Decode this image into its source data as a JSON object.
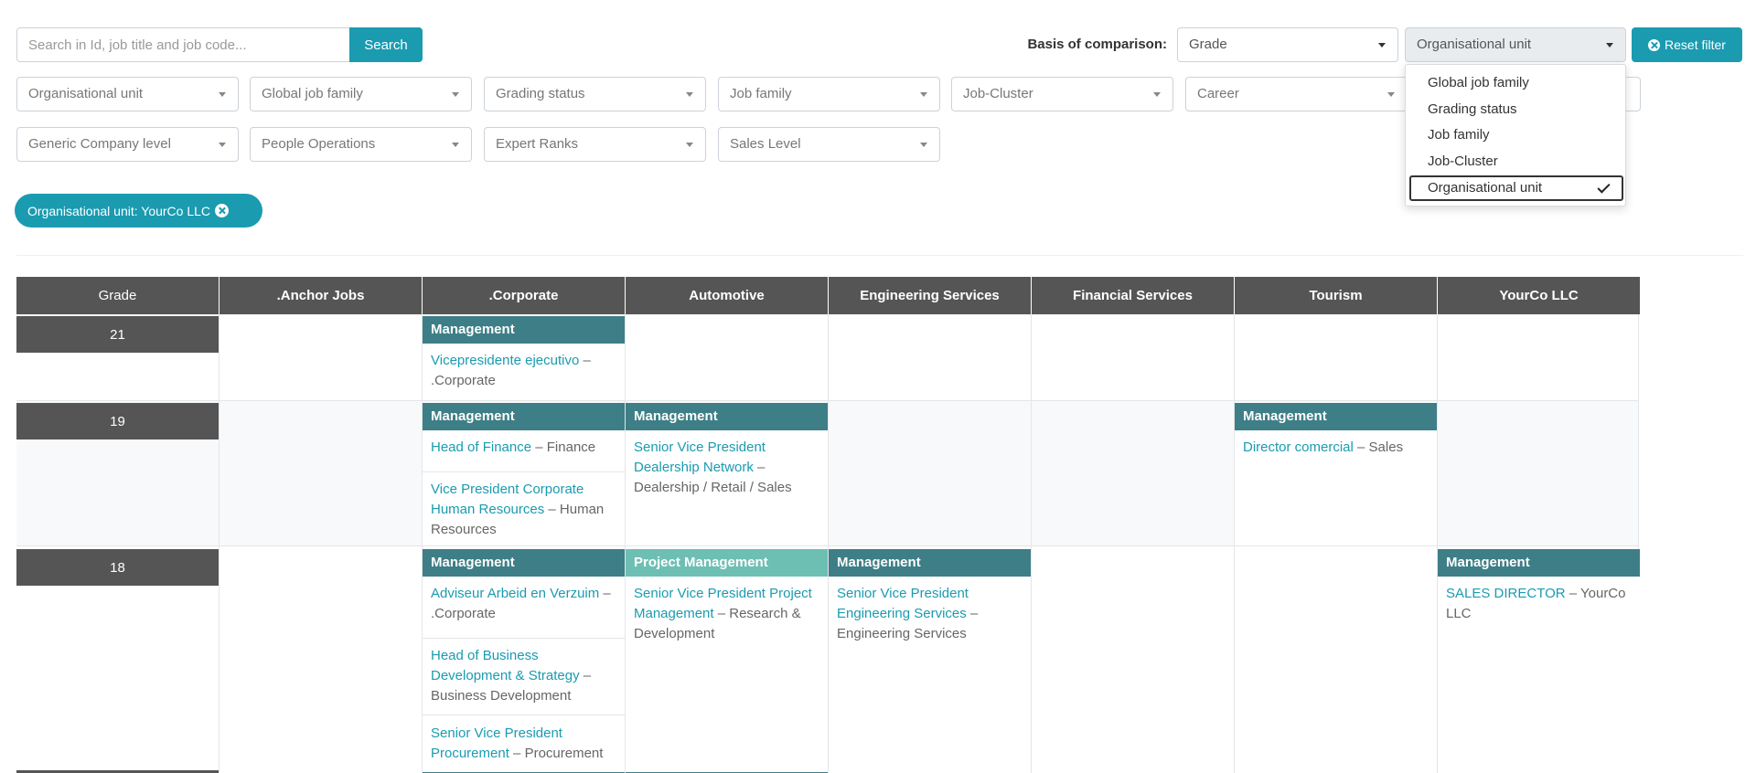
{
  "search": {
    "placeholder": "Search in Id, job title and job code...",
    "button_label": "Search"
  },
  "basis": {
    "label": "Basis of comparison:",
    "grade_select": "Grade",
    "unit_select": "Organisational unit"
  },
  "reset_label": "Reset filter",
  "dropdown": {
    "items": [
      "Global job family",
      "Grading status",
      "Job family",
      "Job-Cluster",
      "Organisational unit"
    ]
  },
  "filters": {
    "row1": [
      "Organisational unit",
      "Global job family",
      "Grading status",
      "Job family",
      "Job-Cluster",
      "Career"
    ],
    "row2": [
      "Generic Company level",
      "People Operations",
      "Expert Ranks",
      "Sales Level"
    ]
  },
  "chip_label": "Organisational unit: YourCo LLC",
  "columns": [
    "Grade",
    ".Anchor Jobs",
    ".Corporate",
    "Automotive",
    "Engineering Services",
    "Financial Services",
    "Tourism",
    "YourCo LLC"
  ],
  "grades": [
    "21",
    "19",
    "18"
  ],
  "cells": {
    "g21_corporate": {
      "family": "Management",
      "jobs": [
        {
          "title": "Vicepresidente ejecutivo",
          "unit": ".Corporate"
        }
      ]
    },
    "g19_corporate": {
      "family": "Management",
      "jobs": [
        {
          "title": "Head of Finance",
          "unit": "Finance"
        },
        {
          "title": "Vice President Corporate Human Resources",
          "unit": "Human Resources"
        }
      ]
    },
    "g19_automotive": {
      "family": "Management",
      "jobs": [
        {
          "title": "Senior Vice President Dealership Network",
          "unit": "Dealership / Retail / Sales"
        }
      ]
    },
    "g19_tourism": {
      "family": "Management",
      "jobs": [
        {
          "title": "Director comercial",
          "unit": "Sales"
        }
      ]
    },
    "g18_corporate": {
      "family": "Management",
      "jobs": [
        {
          "title": "Adviseur Arbeid en Verzuim",
          "unit": ".Corporate"
        },
        {
          "title": "Head of Business Development & Strategy",
          "unit": "Business Development"
        },
        {
          "title": "Senior Vice President Procurement",
          "unit": "Procurement"
        }
      ]
    },
    "g18_automotive": {
      "family": "Project Management",
      "jobs": [
        {
          "title": "Senior Vice President Project Management",
          "unit": "Research & Development"
        }
      ]
    },
    "g18_engineering": {
      "family": "Management",
      "jobs": [
        {
          "title": "Senior Vice President Engineering Services",
          "unit": "Engineering Services"
        }
      ]
    },
    "g18_yourco": {
      "family": "Management",
      "jobs": [
        {
          "title": "SALES DIRECTOR",
          "unit": "YourCo LLC"
        }
      ]
    }
  },
  "separator": " – "
}
